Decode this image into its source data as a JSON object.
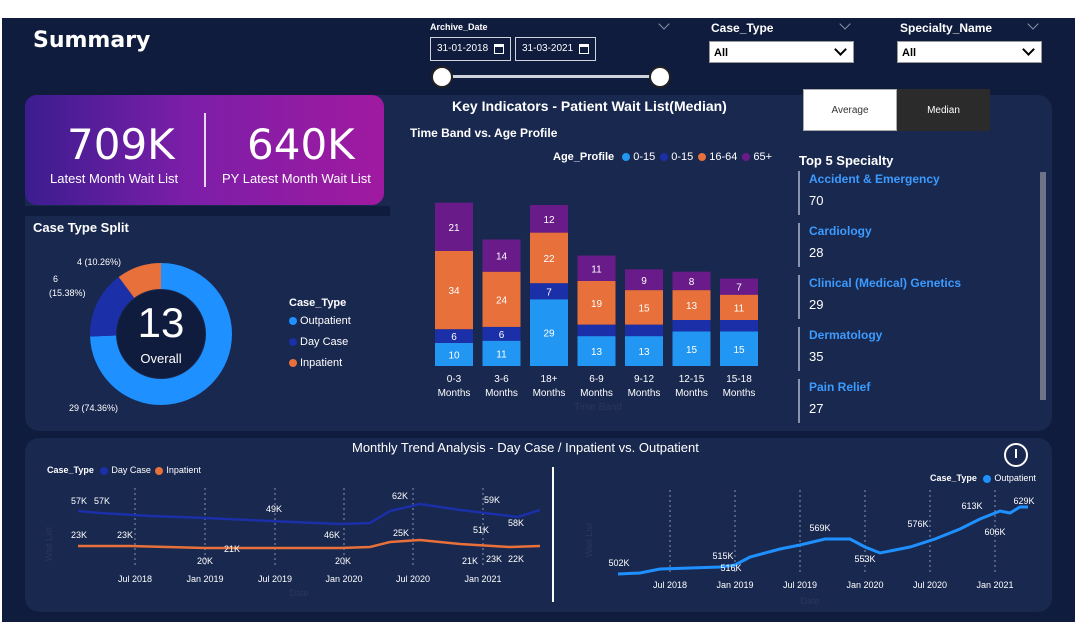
{
  "header": {
    "title": "Summary"
  },
  "filters": {
    "archive_label": "Archive_Date",
    "date_from": "31-01-2018",
    "date_to": "31-03-2021",
    "case_type_label": "Case_Type",
    "case_type_value": "All",
    "specialty_label": "Specialty_Name",
    "specialty_value": "All"
  },
  "kpi": {
    "latest_value": "709K",
    "latest_label": "Latest Month Wait List",
    "py_value": "640K",
    "py_label": "PY Latest Month Wait List"
  },
  "donut": {
    "title": "Case Type Split",
    "center_value": "13",
    "center_label": "Overall",
    "legend_title": "Case_Type",
    "colors": {
      "Outpatient": "#1e90ff",
      "Day Case": "#1a2fa8",
      "Inpatient": "#e8703a"
    },
    "chart_data": {
      "type": "pie",
      "slices": [
        {
          "name": "Outpatient",
          "value": 29,
          "label": "29 (74.36%)"
        },
        {
          "name": "Day Case",
          "value": 6,
          "label": "6 (15.38%)"
        },
        {
          "name": "Inpatient",
          "value": 4,
          "label": "4 (10.26%)"
        }
      ]
    }
  },
  "key_indicators": {
    "title": "Key Indicators - Patient Wait List(Median)",
    "toggle_average": "Average",
    "toggle_median": "Median",
    "bar_title": "Time Band vs. Age Profile",
    "legend_title": "Age_Profile",
    "x_axis_title": "Time Band",
    "legend": [
      {
        "name": "0-15",
        "color": "#2196f3"
      },
      {
        "name": "0-15",
        "color": "#1a2fa8"
      },
      {
        "name": "16-64",
        "color": "#e8703a"
      },
      {
        "name": "65+",
        "color": "#6a1b8a"
      }
    ]
  },
  "chart_data": [
    {
      "type": "bar",
      "stacked": true,
      "categories": [
        "0-3 Months",
        "3-6 Months",
        "18+ Months",
        "6-9 Months",
        "9-12 Months",
        "12-15 Months",
        "15-18 Months"
      ],
      "series": [
        {
          "name": "0-15",
          "color": "#2196f3",
          "values": [
            10,
            11,
            29,
            13,
            13,
            15,
            15
          ]
        },
        {
          "name": "0-15",
          "color": "#1a2fa8",
          "values": [
            6,
            6,
            7,
            5,
            5,
            5,
            5
          ]
        },
        {
          "name": "16-64",
          "color": "#e8703a",
          "values": [
            34,
            24,
            22,
            19,
            15,
            13,
            11
          ]
        },
        {
          "name": "65+",
          "color": "#6a1b8a",
          "values": [
            21,
            14,
            12,
            11,
            9,
            8,
            7
          ]
        }
      ],
      "data_labels": [
        [
          "10",
          "11",
          "29",
          "13",
          "13",
          "15",
          "15"
        ],
        [
          "6",
          "6",
          "7",
          "",
          "",
          "",
          ""
        ],
        [
          "34",
          "24",
          "22",
          "19",
          "15",
          "13",
          "11"
        ],
        [
          "21",
          "14",
          "12",
          "11",
          "9",
          "8",
          "7"
        ]
      ]
    },
    {
      "type": "line",
      "x": [
        "Jul 2018",
        "Jan 2019",
        "Jul 2019",
        "Jan 2020",
        "Jul 2020",
        "Jan 2021"
      ],
      "series": [
        {
          "name": "Day Case",
          "color": "#1a2fa8",
          "labels": [
            "57K",
            "57K",
            "49K",
            "46K",
            "62K",
            "59K",
            "51K",
            "58K"
          ]
        },
        {
          "name": "Inpatient",
          "color": "#e8703a",
          "labels": [
            "23K",
            "23K",
            "20K",
            "21K",
            "20K",
            "25K",
            "21K",
            "23K",
            "22K"
          ]
        }
      ]
    },
    {
      "type": "line",
      "x": [
        "Jul 2018",
        "Jan 2019",
        "Jul 2019",
        "Jan 2020",
        "Jul 2020",
        "Jan 2021"
      ],
      "series": [
        {
          "name": "Outpatient",
          "color": "#1e90ff",
          "labels": [
            "502K",
            "515K",
            "516K",
            "569K",
            "553K",
            "576K",
            "613K",
            "606K",
            "629K"
          ]
        }
      ]
    }
  ],
  "top5": {
    "title": "Top 5 Specialty",
    "items": [
      {
        "name": "Accident & Emergency",
        "value": "70"
      },
      {
        "name": "Cardiology",
        "value": "28"
      },
      {
        "name": "Clinical (Medical) Genetics",
        "value": "29"
      },
      {
        "name": "Dermatology",
        "value": "35"
      },
      {
        "name": "Pain Relief",
        "value": "27"
      }
    ]
  },
  "trend": {
    "title": "Monthly Trend Analysis - Day Case / Inpatient vs. Outpatient",
    "legend_title": "Case_Type",
    "left_legend": [
      "Day Case",
      "Inpatient"
    ],
    "right_legend": [
      "Outpatient"
    ],
    "axis_x_title": "Date",
    "axis_y_title": "Wait List"
  }
}
